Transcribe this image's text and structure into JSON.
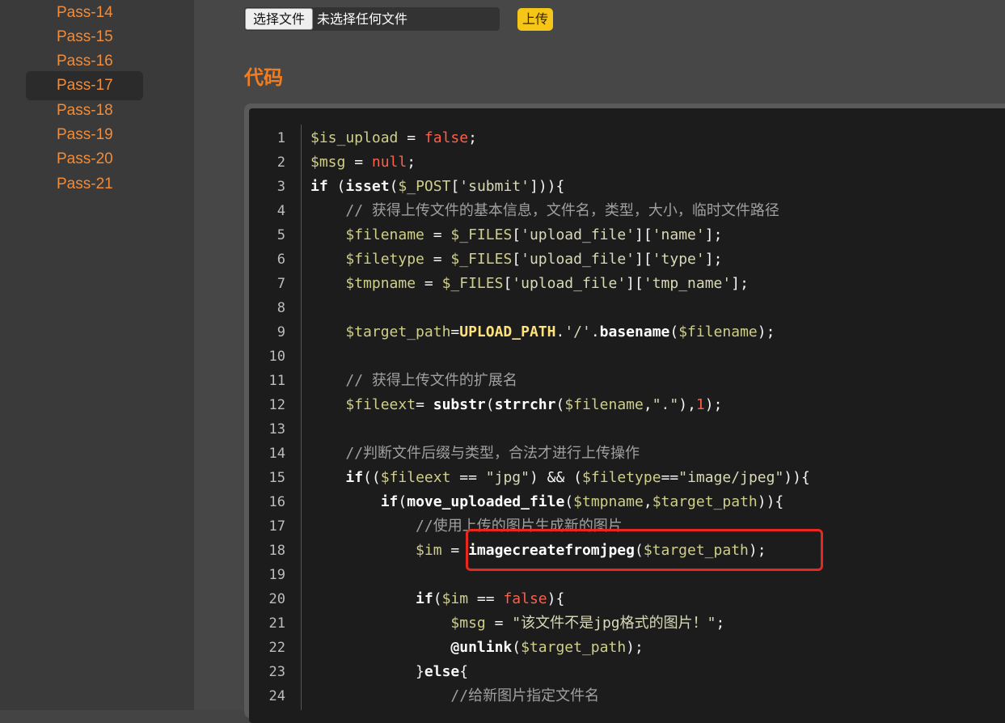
{
  "sidebar": {
    "items": [
      {
        "label": "Pass-14",
        "active": false
      },
      {
        "label": "Pass-15",
        "active": false
      },
      {
        "label": "Pass-16",
        "active": false
      },
      {
        "label": "Pass-17",
        "active": true
      },
      {
        "label": "Pass-18",
        "active": false
      },
      {
        "label": "Pass-19",
        "active": false
      },
      {
        "label": "Pass-20",
        "active": false
      },
      {
        "label": "Pass-21",
        "active": false
      }
    ]
  },
  "upload": {
    "choose_label": "选择文件",
    "no_file_text": "未选择任何文件",
    "upload_label": "上传"
  },
  "section": {
    "title": "代码"
  },
  "code": {
    "line_numbers": [
      "1",
      "2",
      "3",
      "4",
      "5",
      "6",
      "7",
      "8",
      "9",
      "10",
      "11",
      "12",
      "13",
      "14",
      "15",
      "16",
      "17",
      "18",
      "19",
      "20",
      "21",
      "22",
      "23",
      "24"
    ],
    "lines": [
      "$is_upload = false;",
      "$msg = null;",
      "if (isset($_POST['submit'])){",
      "    // 获得上传文件的基本信息，文件名，类型，大小，临时文件路径",
      "    $filename = $_FILES['upload_file']['name'];",
      "    $filetype = $_FILES['upload_file']['type'];",
      "    $tmpname = $_FILES['upload_file']['tmp_name'];",
      "",
      "    $target_path=UPLOAD_PATH.'/'.basename($filename);",
      "",
      "    // 获得上传文件的扩展名",
      "    $fileext= substr(strrchr($filename,\".\"),1);",
      "",
      "    //判断文件后缀与类型，合法才进行上传操作",
      "    if(($fileext == \"jpg\") && ($filetype==\"image/jpeg\")){",
      "        if(move_uploaded_file($tmpname,$target_path)){",
      "            //使用上传的图片生成新的图片",
      "            $im = imagecreatefromjpeg($target_path);",
      "",
      "            if($im == false){",
      "                $msg = \"该文件不是jpg格式的图片！\";",
      "                @unlink($target_path);",
      "            }else{",
      "                //给新图片指定文件名"
    ]
  },
  "colors": {
    "accent": "#f08c3a",
    "title": "#f07d22",
    "upload_button": "#f5c518",
    "highlight_border": "#e8281f"
  }
}
